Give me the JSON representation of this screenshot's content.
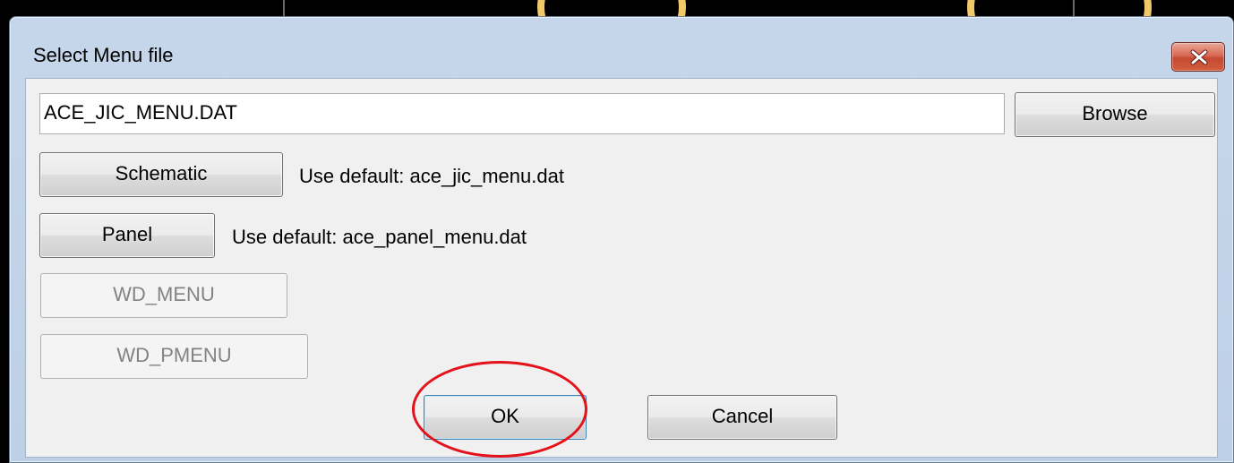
{
  "dialog": {
    "title": "Select Menu file",
    "close_icon": "close-x-icon"
  },
  "menu_file": {
    "value": "ACE_JIC_MENU.DAT"
  },
  "buttons": {
    "browse": "Browse",
    "schematic": "Schematic",
    "panel": "Panel",
    "wd_menu": "WD_MENU",
    "wd_pmenu": "WD_PMENU",
    "ok": "OK",
    "cancel": "Cancel"
  },
  "labels": {
    "schematic_default": "Use default: ace_jic_menu.dat",
    "panel_default": "Use default: ace_panel_menu.dat"
  },
  "colors": {
    "close_button": "#c44a31",
    "highlight_circle": "#e3121b",
    "title_bar": "#c6d6ea",
    "dialog_body": "#f0f0f0"
  }
}
